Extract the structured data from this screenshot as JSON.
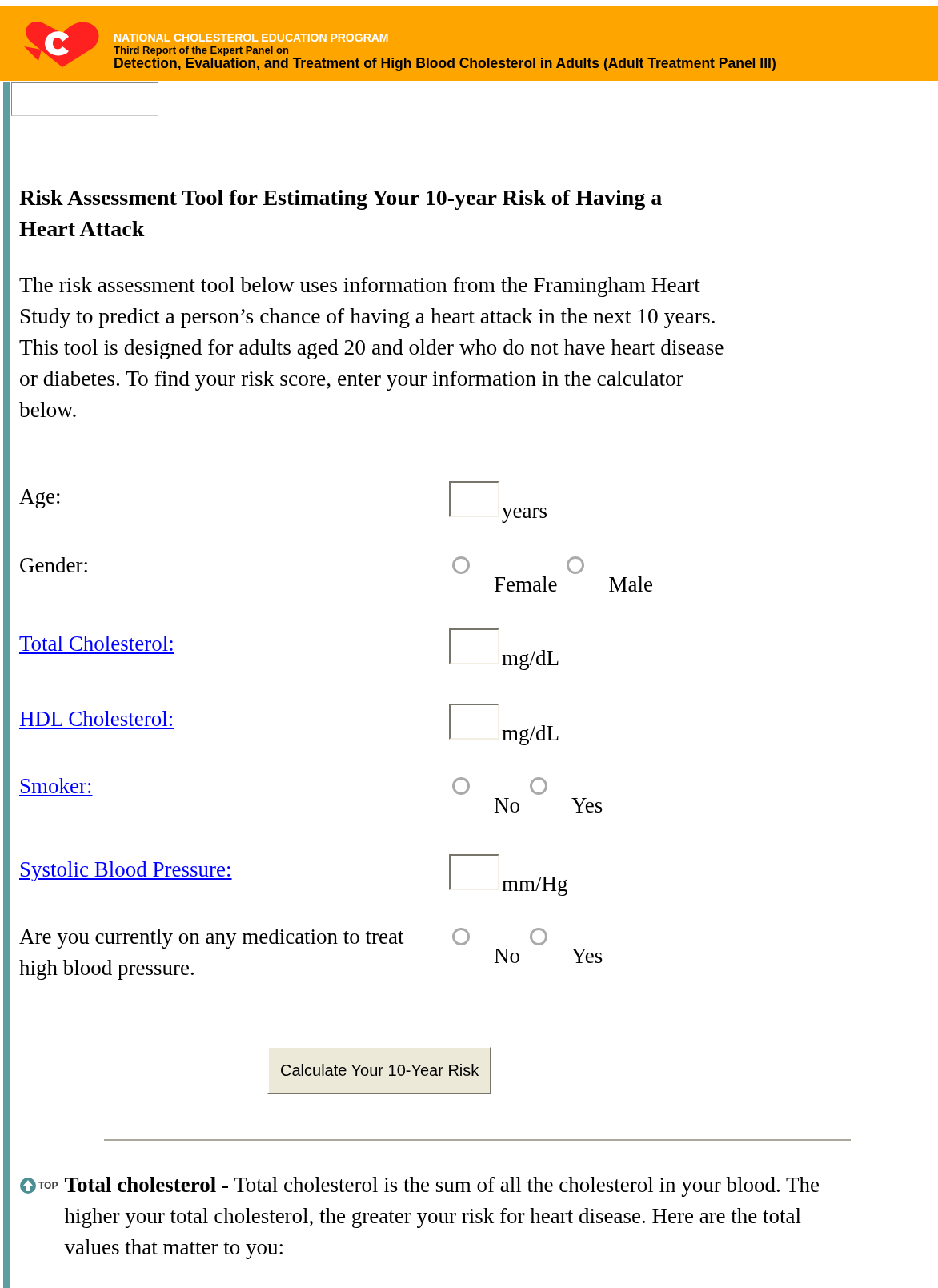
{
  "header": {
    "program": "NATIONAL CHOLESTEROL EDUCATION PROGRAM",
    "subtitle": "Third Report of the Expert Panel on",
    "title": "Detection, Evaluation, and Treatment of High Blood Cholesterol in Adults (Adult Treatment Panel III)"
  },
  "heading": "Risk Assessment Tool for Estimating Your 10-year Risk of Having a Heart Attack",
  "intro": "The risk assessment tool below uses information from the Framingham Heart Study to predict a person’s chance of having a heart attack in the next 10 years. This tool is designed for adults aged 20 and older who do not have heart disease or diabetes. To find your risk score, enter your information in the calculator below.",
  "form": {
    "rows": [
      {
        "kind": "text",
        "label": "Age:",
        "link": false,
        "unit": "years"
      },
      {
        "kind": "radio",
        "label": "Gender:",
        "link": false,
        "options": [
          {
            "label": "Female",
            "selected": false
          },
          {
            "label": "Male",
            "selected": false
          }
        ]
      },
      {
        "kind": "text",
        "label": "Total Cholesterol:",
        "link": true,
        "unit": "mg/dL"
      },
      {
        "kind": "text",
        "label": "HDL Cholesterol:",
        "link": true,
        "unit": "mg/dL"
      },
      {
        "kind": "radio",
        "label": "Smoker:",
        "link": true,
        "options": [
          {
            "label": "No",
            "selected": false
          },
          {
            "label": "Yes",
            "selected": false
          }
        ]
      },
      {
        "kind": "text",
        "label": "Systolic Blood Pressure:",
        "link": true,
        "unit": "mm/Hg"
      },
      {
        "kind": "radio",
        "label": "Are you currently on any medication to treat high blood pressure.",
        "link": false,
        "options": [
          {
            "label": "No",
            "selected": false
          },
          {
            "label": "Yes",
            "selected": false
          }
        ]
      }
    ],
    "button": "Calculate Your 10-Year Risk"
  },
  "definition": {
    "top_label": "TOP",
    "text": "**Total cholesterol** - Total cholesterol is the sum of all the cholesterol in your blood. The higher your total cholesterol, the greater your risk for heart disease. Here are the total values that matter to you:"
  }
}
